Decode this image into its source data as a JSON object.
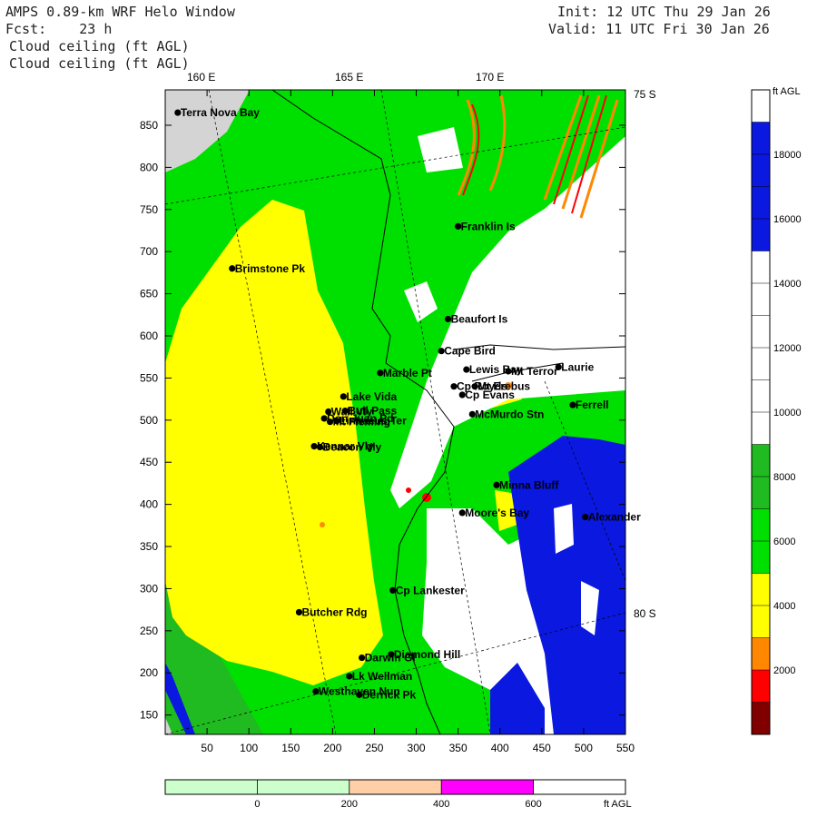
{
  "header": {
    "title": "AMPS 0.89-km WRF Helo Window",
    "fcst": "Fcst:    23 h",
    "field1": "Cloud ceiling (ft AGL)",
    "field2": "Cloud ceiling (ft AGL)",
    "init": "Init: 12 UTC Thu 29 Jan 26",
    "valid": "Valid: 11 UTC Fri 30 Jan 26"
  },
  "map": {
    "lon_labels": [
      "160 E",
      "165 E",
      "170 E"
    ],
    "lat_labels": [
      "75 S",
      "80 S"
    ],
    "x_ticks": [
      "50",
      "100",
      "150",
      "200",
      "250",
      "300",
      "350",
      "400",
      "450",
      "500",
      "550"
    ],
    "y_ticks": [
      "850",
      "800",
      "750",
      "700",
      "650",
      "600",
      "550",
      "500",
      "450",
      "400",
      "350",
      "300",
      "250",
      "200",
      "150"
    ],
    "stations": [
      {
        "name": "Terra Nova Bay",
        "x": 15,
        "y": 865
      },
      {
        "name": "Franklin Is",
        "x": 350,
        "y": 730
      },
      {
        "name": "Brimstone Pk",
        "x": 80,
        "y": 680
      },
      {
        "name": "Beaufort Is",
        "x": 338,
        "y": 620
      },
      {
        "name": "Cape Bird",
        "x": 330,
        "y": 582
      },
      {
        "name": "Lewis Bay",
        "x": 360,
        "y": 560
      },
      {
        "name": "Laurie",
        "x": 470,
        "y": 563
      },
      {
        "name": "Marble Pt",
        "x": 257,
        "y": 556
      },
      {
        "name": "Mt Terror",
        "x": 410,
        "y": 558
      },
      {
        "name": "Cp Royds",
        "x": 345,
        "y": 540
      },
      {
        "name": "Mt Erebus",
        "x": 370,
        "y": 540
      },
      {
        "name": "Lake Vida",
        "x": 213,
        "y": 528
      },
      {
        "name": "Cp Evans",
        "x": 355,
        "y": 530
      },
      {
        "name": "Ferrell",
        "x": 487,
        "y": 518
      },
      {
        "name": "Wall Vly",
        "x": 195,
        "y": 510
      },
      {
        "name": "Bull Pass",
        "x": 215,
        "y": 511
      },
      {
        "name": "McMurdo Stn",
        "x": 367,
        "y": 507
      },
      {
        "name": "Don Juan Pd",
        "x": 190,
        "y": 502
      },
      {
        "name": "Mt Fleming",
        "x": 197,
        "y": 498
      },
      {
        "name": "Linnaeus Ter",
        "x": 205,
        "y": 499
      },
      {
        "name": "Kennar Vly",
        "x": 178,
        "y": 469
      },
      {
        "name": "Beacon Vly",
        "x": 185,
        "y": 468
      },
      {
        "name": "Minna Bluff",
        "x": 396,
        "y": 423
      },
      {
        "name": "Moore's Bay",
        "x": 355,
        "y": 390
      },
      {
        "name": "Alexander",
        "x": 502,
        "y": 385
      },
      {
        "name": "Cp Lankester",
        "x": 272,
        "y": 298
      },
      {
        "name": "Butcher Rdg",
        "x": 160,
        "y": 272
      },
      {
        "name": "Diamond Hill",
        "x": 270,
        "y": 222
      },
      {
        "name": "Darwin Gl",
        "x": 235,
        "y": 218
      },
      {
        "name": "Lk Wellman",
        "x": 220,
        "y": 196
      },
      {
        "name": "Westhaven Nun",
        "x": 180,
        "y": 178
      },
      {
        "name": "Derrick Pk",
        "x": 232,
        "y": 174
      }
    ]
  },
  "colorbar_right": {
    "unit": "ft AGL",
    "ticks": [
      "18000",
      "16000",
      "14000",
      "12000",
      "10000",
      "8000",
      "6000",
      "4000",
      "2000"
    ],
    "colors": [
      "#800000",
      "#ff0000",
      "#ff8800",
      "#ffff00",
      "#ffff00",
      "#00e000",
      "#00e000",
      "#20bb20",
      "#20bb20",
      "#ffffff",
      "#ffffff",
      "#ffffff",
      "#ffffff",
      "#ffffff",
      "#ffffff",
      "#0a18e0",
      "#0a18e0",
      "#0a18e0",
      "#0a18e0",
      "#ffffff"
    ]
  },
  "colorbar_bottom": {
    "ticks": [
      "0",
      "200",
      "400",
      "600"
    ],
    "unit": "ft AGL",
    "colors": [
      "#ccffcc",
      "#ccffcc",
      "#ffd0a8",
      "#ff00ff",
      "#ffffff"
    ]
  }
}
